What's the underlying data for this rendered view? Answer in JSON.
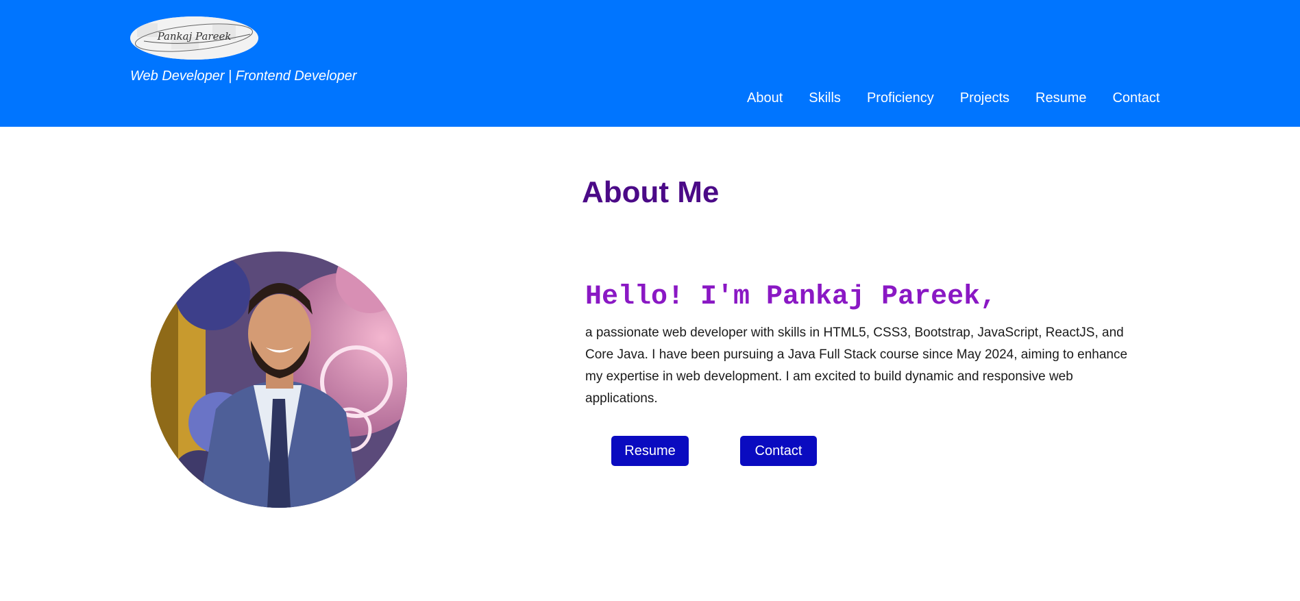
{
  "header": {
    "logo_text": "Pankaj Pareek",
    "tagline": "Web Developer | Frontend Developer",
    "background_color": "#0075ff",
    "nav": [
      {
        "label": "About"
      },
      {
        "label": "Skills"
      },
      {
        "label": "Proficiency"
      },
      {
        "label": "Projects"
      },
      {
        "label": "Resume"
      },
      {
        "label": "Contact"
      }
    ]
  },
  "about": {
    "title": "About Me",
    "greeting": "Hello! I'm Pankaj Pareek,",
    "bio": "a passionate web developer with skills in HTML5, CSS3, Bootstrap, JavaScript, ReactJS, and Core Java. I have been pursuing a Java Full Stack course since May 2024, aiming to enhance my expertise in web development. I am excited to build dynamic and responsive web applications.",
    "buttons": {
      "resume": "Resume",
      "contact": "Contact"
    },
    "title_color": "#4b0a87",
    "greeting_color": "#8a18c4",
    "button_color": "#0a0bc0"
  }
}
